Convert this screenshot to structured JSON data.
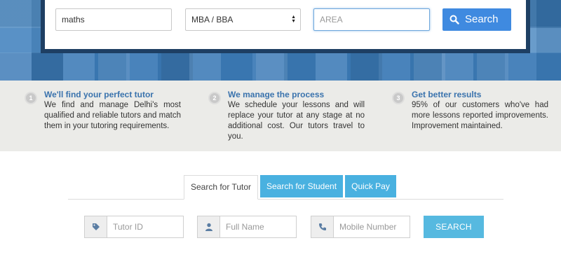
{
  "hero_search": {
    "keyword_value": "maths",
    "course_selected": "MBA / BBA",
    "area_placeholder": "AREA",
    "search_label": "Search"
  },
  "steps": [
    {
      "number": "1",
      "title": "We'll find your perfect tutor",
      "body": "We find and manage Delhi's most qualified and reliable tutors and match them in your tutoring requirements."
    },
    {
      "number": "2",
      "title": "We manage the process",
      "body": "We schedule your lessons and will replace your tutor at any stage at no additional cost. Our tutors travel to you."
    },
    {
      "number": "3",
      "title": "Get better results",
      "body": "95% of our customers who've had more lessons reported improvements. Improvement maintained."
    }
  ],
  "tabs": [
    {
      "label": "Search for Tutor",
      "active": true
    },
    {
      "label": "Search for Student",
      "active": false
    },
    {
      "label": "Quick Pay",
      "active": false
    }
  ],
  "lower_form": {
    "tutor_id_placeholder": "Tutor ID",
    "full_name_placeholder": "Full Name",
    "mobile_placeholder": "Mobile Number",
    "search_label": "SEARCH"
  },
  "icons": {
    "search": "search-icon",
    "tag": "tag-icon",
    "user": "user-icon",
    "phone": "phone-icon",
    "select_arrows": "updown-arrows-icon"
  },
  "colors": {
    "hero_blue": "#3d7fbd",
    "card_frame": "#1e3f63",
    "primary_button": "#3f8ae0",
    "tab_blue": "#49b1e0",
    "step_title": "#3a73ad",
    "steps_bg": "#ebebe8"
  }
}
